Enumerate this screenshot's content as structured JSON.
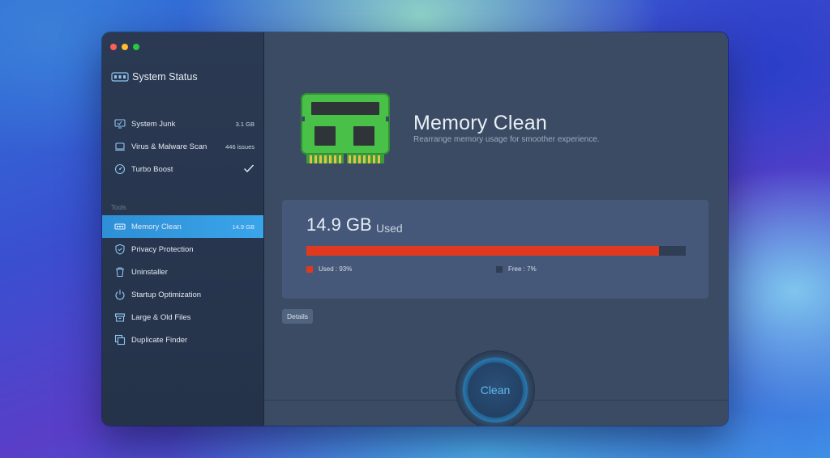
{
  "sidebar": {
    "title": "System Status",
    "items": [
      {
        "label": "System Junk",
        "value": "3.1 GB",
        "icon": "monitor-icon"
      },
      {
        "label": "Virus & Malware Scan",
        "value": "446 issues",
        "icon": "laptop-scan-icon"
      },
      {
        "label": "Turbo Boost",
        "value": "",
        "icon": "speedometer-icon",
        "status": "check"
      }
    ],
    "tools_label": "Tools",
    "tools": [
      {
        "label": "Memory Clean",
        "value": "14.9 GB",
        "icon": "memory-icon",
        "active": true
      },
      {
        "label": "Privacy Protection",
        "value": "",
        "icon": "shield-icon"
      },
      {
        "label": "Uninstaller",
        "value": "",
        "icon": "trash-icon"
      },
      {
        "label": "Startup Optimization",
        "value": "",
        "icon": "power-icon"
      },
      {
        "label": "Large & Old Files",
        "value": "",
        "icon": "archive-icon"
      },
      {
        "label": "Duplicate Finder",
        "value": "",
        "icon": "duplicate-icon"
      }
    ]
  },
  "main": {
    "title": "Memory Clean",
    "subtitle": "Rearrange memory usage for smoother experience.",
    "used_size": "14.9 GB",
    "used_word": "Used",
    "used_fraction": 0.93,
    "legend_used": "Used : 93%",
    "legend_free": "Free : 7%",
    "details_label": "Details",
    "clean_label": "Clean"
  },
  "colors": {
    "accent": "#3aa5ea",
    "used_bar": "#e1391f",
    "free_swatch": "#2f3d55",
    "chip_green": "#4cc24a"
  }
}
